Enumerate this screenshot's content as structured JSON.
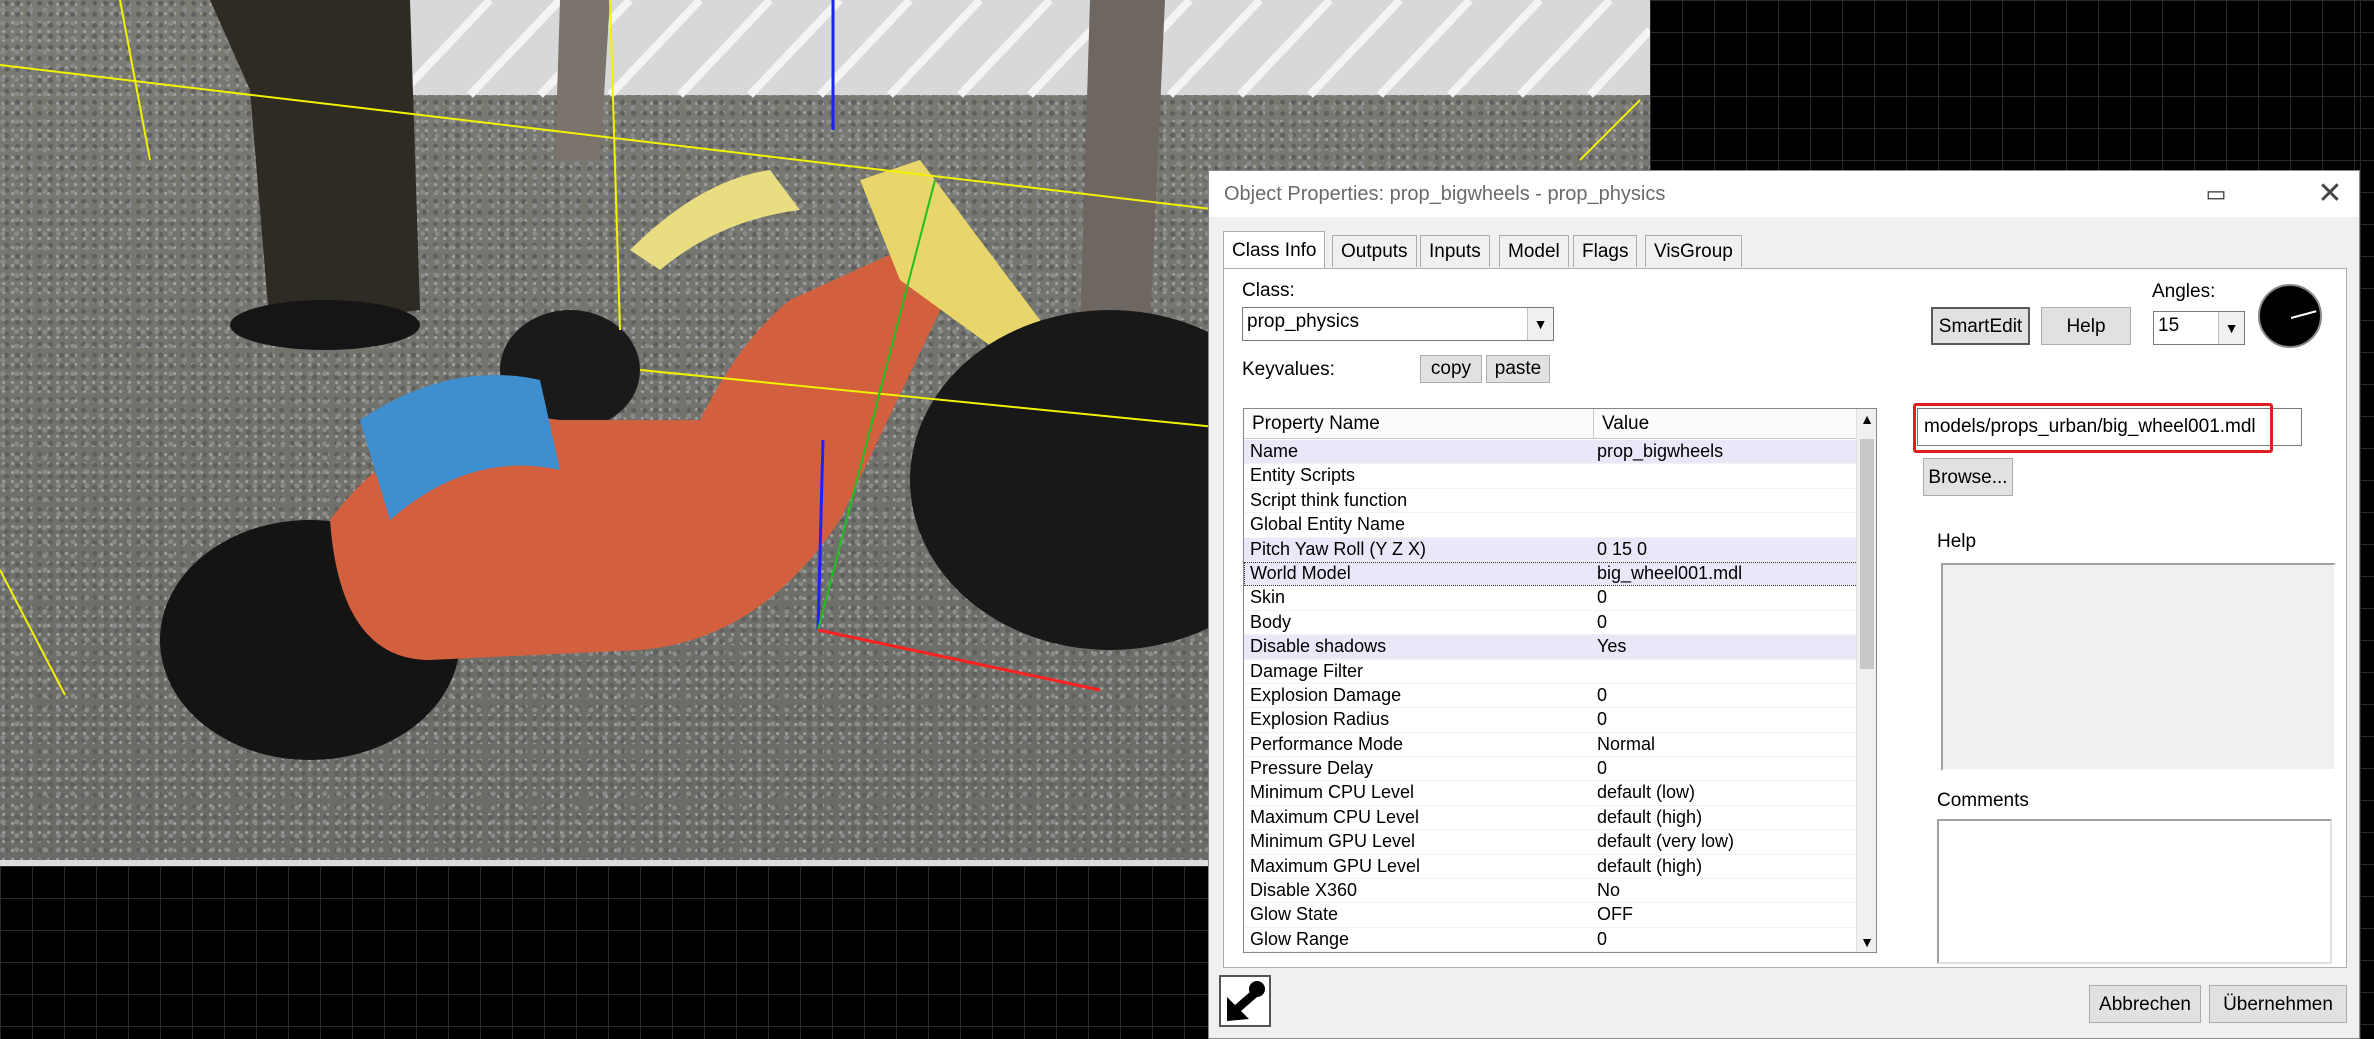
{
  "dialog": {
    "title": "Object Properties: prop_bigwheels - prop_physics",
    "restore_icon": "restore-window-icon",
    "close_icon": "close-icon"
  },
  "tabs": [
    {
      "label": "Class Info",
      "active": true
    },
    {
      "label": "Outputs"
    },
    {
      "label": "Inputs"
    },
    {
      "label": "Model"
    },
    {
      "label": "Flags"
    },
    {
      "label": "VisGroup"
    }
  ],
  "class_info": {
    "class_label": "Class:",
    "class_value": "prop_physics",
    "keyvalues_label": "Keyvalues:",
    "copy_label": "copy",
    "paste_label": "paste",
    "smartedit_label": "SmartEdit",
    "help_button_label": "Help",
    "angles_label": "Angles:",
    "angles_value": "15",
    "model_value": "models/props_urban/big_wheel001.mdl",
    "browse_label": "Browse...",
    "help_label": "Help",
    "comments_label": "Comments"
  },
  "property_grid": {
    "columns": [
      "Property Name",
      "Value"
    ],
    "rows": [
      {
        "name": "Name",
        "value": "prop_bigwheels",
        "highlight": true
      },
      {
        "name": "Entity Scripts",
        "value": ""
      },
      {
        "name": "Script think function",
        "value": ""
      },
      {
        "name": "Global Entity Name",
        "value": ""
      },
      {
        "name": "Pitch Yaw Roll (Y Z X)",
        "value": "0 15 0",
        "highlight": true
      },
      {
        "name": "World Model",
        "value": "big_wheel001.mdl",
        "highlight": true,
        "selected": true
      },
      {
        "name": "Skin",
        "value": "0"
      },
      {
        "name": "Body",
        "value": "0"
      },
      {
        "name": "Disable shadows",
        "value": "Yes",
        "highlight": true
      },
      {
        "name": "Damage Filter",
        "value": ""
      },
      {
        "name": "Explosion Damage",
        "value": "0"
      },
      {
        "name": "Explosion Radius",
        "value": "0"
      },
      {
        "name": "Performance Mode",
        "value": "Normal"
      },
      {
        "name": "Pressure Delay",
        "value": "0"
      },
      {
        "name": "Minimum CPU Level",
        "value": "default (low)"
      },
      {
        "name": "Maximum CPU Level",
        "value": "default (high)"
      },
      {
        "name": "Minimum GPU Level",
        "value": "default (very low)"
      },
      {
        "name": "Maximum GPU Level",
        "value": "default (high)"
      },
      {
        "name": "Disable X360",
        "value": "No"
      },
      {
        "name": "Glow State",
        "value": "OFF"
      },
      {
        "name": "Glow Range",
        "value": "0"
      }
    ]
  },
  "footer": {
    "cancel_label": "Abbrechen",
    "apply_label": "Übernehmen",
    "picker_icon": "entity-picker-icon"
  },
  "colors": {
    "highlight_box": "#e02020",
    "row_highlight": "#e8e8f8"
  }
}
